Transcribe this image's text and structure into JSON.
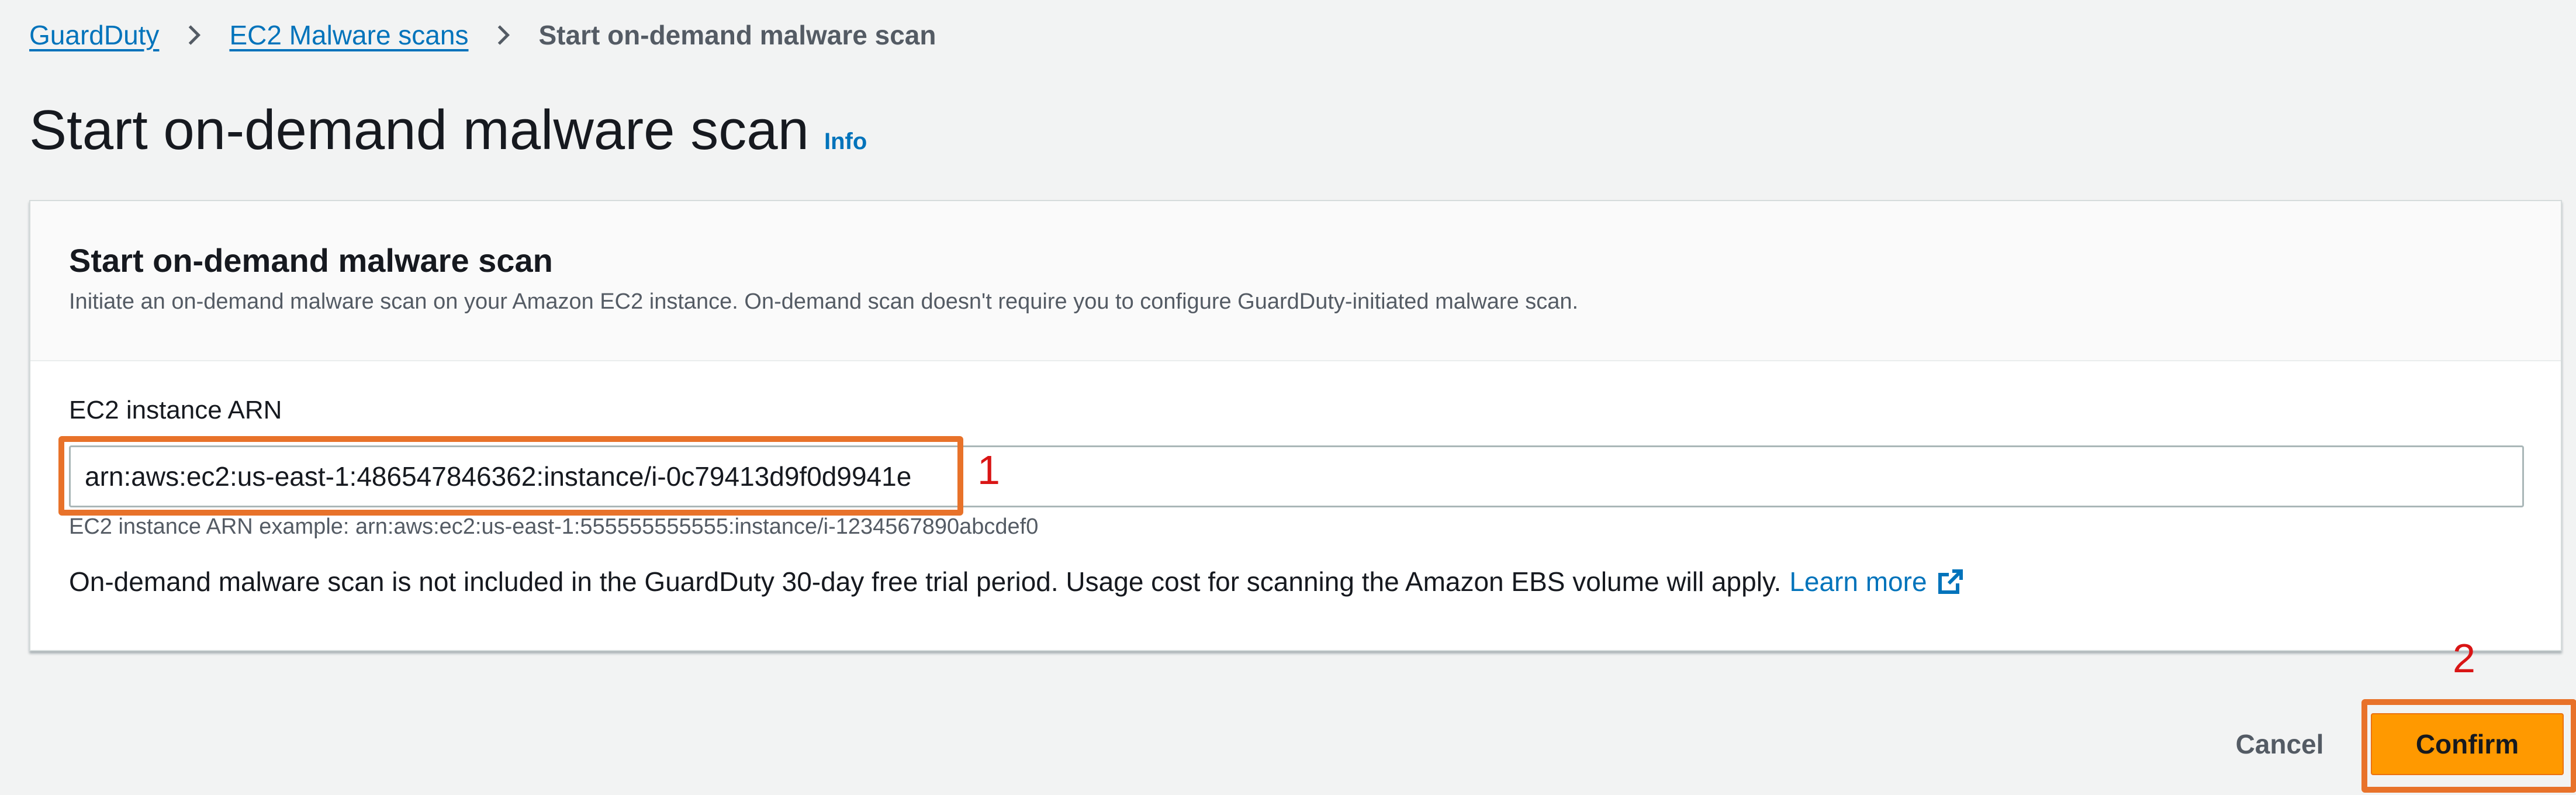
{
  "breadcrumb": {
    "items": [
      {
        "label": "GuardDuty"
      },
      {
        "label": "EC2 Malware scans"
      },
      {
        "label": "Start on-demand malware scan"
      }
    ]
  },
  "page": {
    "title": "Start on-demand malware scan",
    "info_label": "Info"
  },
  "panel": {
    "title": "Start on-demand malware scan",
    "description": "Initiate an on-demand malware scan on your Amazon EC2 instance. On-demand scan doesn't require you to configure GuardDuty-initiated malware scan.",
    "field_label": "EC2 instance ARN",
    "field_value": "arn:aws:ec2:us-east-1:486547846362:instance/i-0c79413d9f0d9941e",
    "field_hint": "EC2 instance ARN example: arn:aws:ec2:us-east-1:555555555555:instance/i-1234567890abcdef0",
    "notice": "On-demand malware scan is not included in the GuardDuty 30-day free trial period. Usage cost for scanning the Amazon EBS volume will apply.",
    "learn_more": "Learn more"
  },
  "actions": {
    "cancel": "Cancel",
    "confirm": "Confirm"
  },
  "annotations": {
    "first": "1",
    "second": "2"
  },
  "colors": {
    "link": "#0073bb",
    "primary_button": "#ff9900",
    "annotation_box": "#e8722a",
    "annotation_number": "#d91515"
  },
  "icons": [
    "chevron-right-icon",
    "external-link-icon"
  ]
}
